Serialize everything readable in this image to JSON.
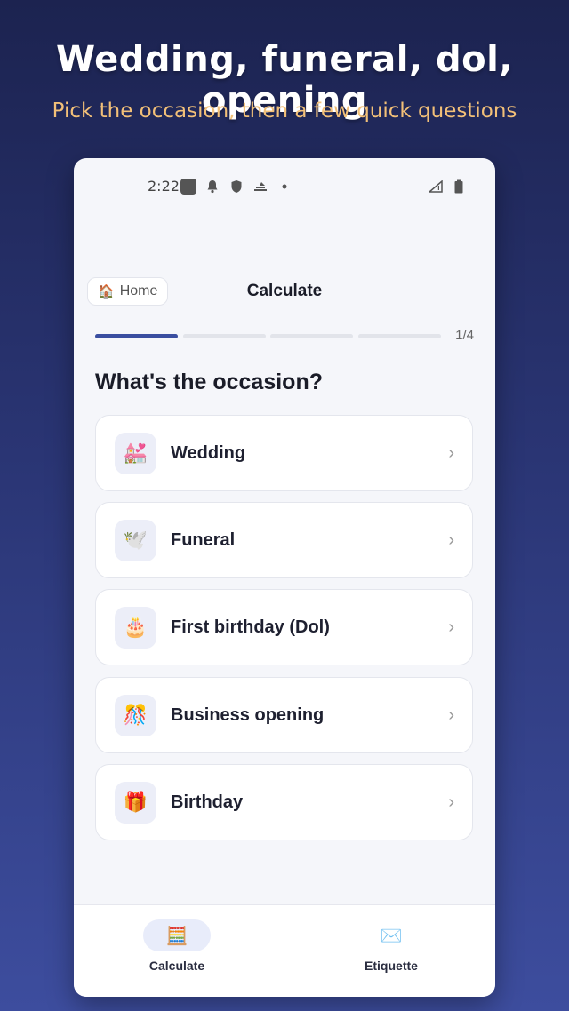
{
  "promo": {
    "headline": "Wedding, funeral, dol, opening",
    "subhead": "Pick the occasion, then a few quick questions"
  },
  "status_bar": {
    "time": "2:22",
    "icons_left": [
      "app-square-icon",
      "bell-icon",
      "shield-icon",
      "sim-icon",
      "dot-icon"
    ],
    "icons_right": [
      "signal-icon",
      "battery-icon"
    ]
  },
  "topbar": {
    "home_icon": "🏠",
    "home_label": "Home",
    "title": "Calculate"
  },
  "progress": {
    "current_step": 1,
    "total_steps": 4,
    "label": "1/4"
  },
  "question": "What's the occasion?",
  "options": [
    {
      "icon": "💒",
      "label": "Wedding"
    },
    {
      "icon": "🕊️",
      "label": "Funeral"
    },
    {
      "icon": "🎂",
      "label": "First birthday (Dol)"
    },
    {
      "icon": "🎊",
      "label": "Business opening"
    },
    {
      "icon": "🎁",
      "label": "Birthday"
    }
  ],
  "chevron": "›",
  "bottom_nav": [
    {
      "icon": "🧮",
      "label": "Calculate",
      "active": true
    },
    {
      "icon": "✉️",
      "label": "Etiquette",
      "active": false
    }
  ],
  "colors": {
    "accent": "#3a4ea0",
    "subhead": "#f2c078",
    "background_top": "#1c2350",
    "background_bottom": "#3d4d9e"
  }
}
